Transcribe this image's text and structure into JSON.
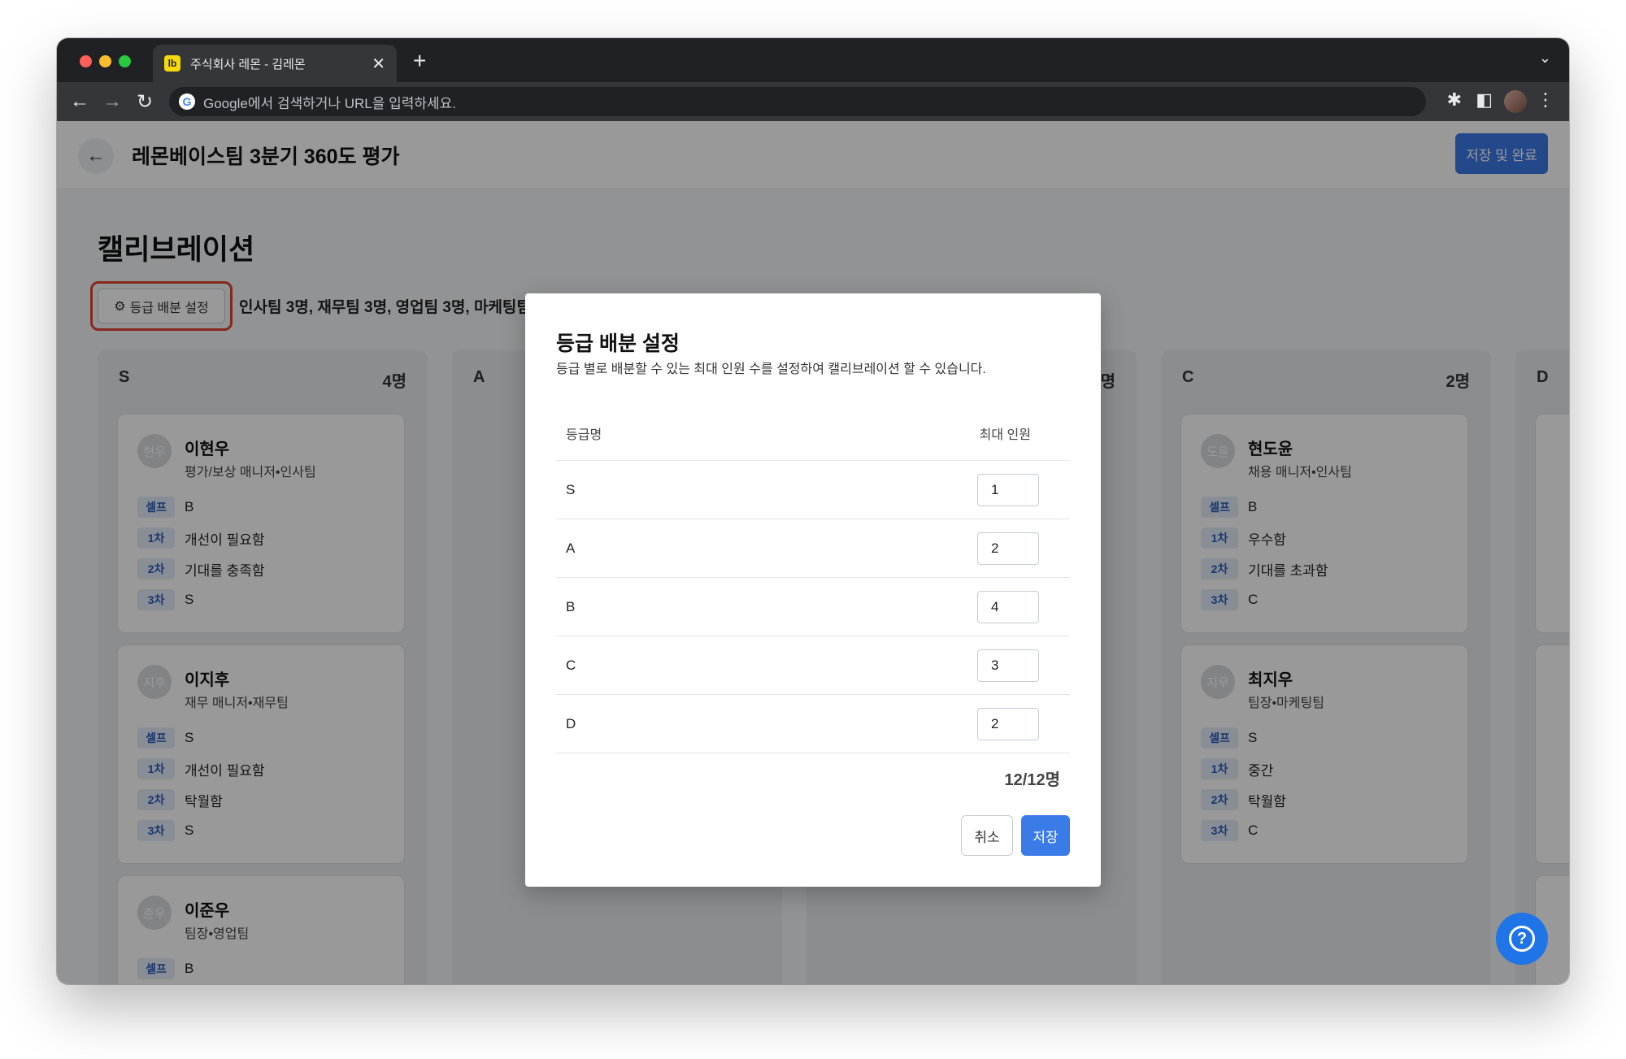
{
  "browser": {
    "tab_favicon": "lb",
    "tab_title": "주식회사 레몬 - 김레몬",
    "address_placeholder": "Google에서 검색하거나 URL을 입력하세요.",
    "close_glyph": "✕",
    "new_tab_glyph": "+",
    "dropdown_glyph": "⌄",
    "back_glyph": "←",
    "forward_glyph": "→",
    "reload_glyph": "↻",
    "google_glyph": "G",
    "extensions_glyph": "✱",
    "sidepanel_glyph": "◧",
    "menu_glyph": "⋮"
  },
  "header": {
    "back_glyph": "←",
    "title": "레몬베이스팀 3분기 360도 평가",
    "save_complete_label": "저장 및 완료"
  },
  "calibration": {
    "section_title": "캘리브레이션",
    "grade_button_label": "등급 배분 설정",
    "gear_glyph": "⚙",
    "team_summary": "인사팀 3명, 재무팀 3명, 영업팀 3명, 마케팅팀"
  },
  "columns": [
    {
      "grade": "S",
      "count": "4명"
    },
    {
      "grade": "A",
      "count": ""
    },
    {
      "grade": "",
      "count": "명"
    },
    {
      "grade": "C",
      "count": "2명"
    },
    {
      "grade": "D",
      "count": ""
    }
  ],
  "cards": {
    "s": [
      {
        "avatar": "현우",
        "name": "이현우",
        "role": "평가/보상 매니저•인사팀",
        "evals": [
          {
            "tag": "셀프",
            "value": "B"
          },
          {
            "tag": "1차",
            "value": "개선이 필요함"
          },
          {
            "tag": "2차",
            "value": "기대를 충족함"
          },
          {
            "tag": "3차",
            "value": "S"
          }
        ]
      },
      {
        "avatar": "지후",
        "name": "이지후",
        "role": "재무 매니저•재무팀",
        "evals": [
          {
            "tag": "셀프",
            "value": "S"
          },
          {
            "tag": "1차",
            "value": "개선이 필요함"
          },
          {
            "tag": "2차",
            "value": "탁월함"
          },
          {
            "tag": "3차",
            "value": "S"
          }
        ]
      },
      {
        "avatar": "준우",
        "name": "이준우",
        "role": "팀장•영업팀",
        "evals": [
          {
            "tag": "셀프",
            "value": "B"
          }
        ]
      }
    ],
    "c": [
      {
        "avatar": "도윤",
        "name": "현도윤",
        "role": "채용 매니저•인사팀",
        "evals": [
          {
            "tag": "셀프",
            "value": "B"
          },
          {
            "tag": "1차",
            "value": "우수함"
          },
          {
            "tag": "2차",
            "value": "기대를 초과함"
          },
          {
            "tag": "3차",
            "value": "C"
          }
        ]
      },
      {
        "avatar": "지우",
        "name": "최지우",
        "role": "팀장•마케팅팀",
        "evals": [
          {
            "tag": "셀프",
            "value": "S"
          },
          {
            "tag": "1차",
            "value": "중간"
          },
          {
            "tag": "2차",
            "value": "탁월함"
          },
          {
            "tag": "3차",
            "value": "C"
          }
        ]
      }
    ]
  },
  "modal": {
    "title": "등급 배분 설정",
    "description": "등급 별로 배분할 수 있는 최대 인원 수를 설정하여 캘리브레이션 할 수 있습니다.",
    "col_grade": "등급명",
    "col_max": "최대 인원",
    "rows": [
      {
        "grade": "S",
        "max": "1"
      },
      {
        "grade": "A",
        "max": "2"
      },
      {
        "grade": "B",
        "max": "4"
      },
      {
        "grade": "C",
        "max": "3"
      },
      {
        "grade": "D",
        "max": "2"
      }
    ],
    "total": "12/12명",
    "cancel_label": "취소",
    "save_label": "저장"
  },
  "help_glyph": "?",
  "colors": {
    "accent": "#3b7be8",
    "highlight": "#e0442f",
    "tag_bg": "#e4ecf8",
    "tag_text": "#2a5cb8"
  }
}
